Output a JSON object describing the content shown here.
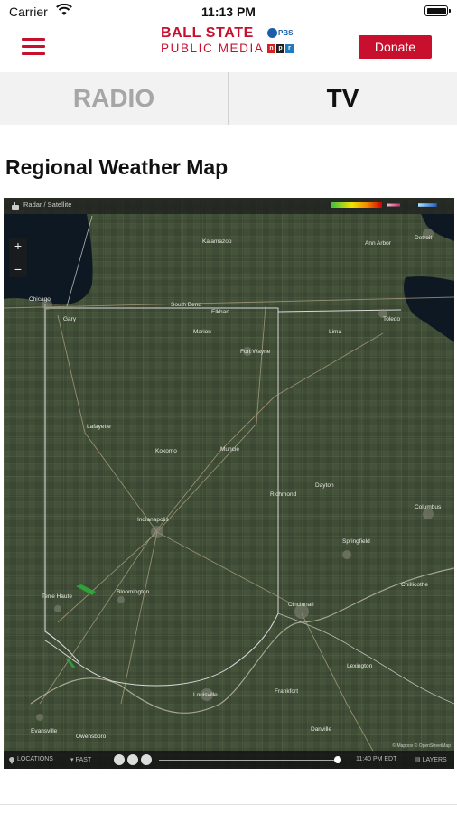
{
  "status_bar": {
    "carrier": "Carrier",
    "time": "11:13 PM"
  },
  "header": {
    "brand_line1": "BALL STATE",
    "brand_line2": "PUBLIC MEDIA",
    "pbs_label": "PBS",
    "npr_letters": [
      "n",
      "p",
      "r"
    ],
    "npr_colors": [
      "#d62021",
      "#1e1e1e",
      "#237bbd"
    ],
    "donate_label": "Donate",
    "accent_color": "#c8102e"
  },
  "tabs": [
    {
      "label": "RADIO",
      "active": false
    },
    {
      "label": "TV",
      "active": true
    }
  ],
  "page_title": "Regional Weather Map",
  "map": {
    "layer_label": "Radar / Satellite",
    "zoom_in": "+",
    "zoom_out": "−",
    "locations_label": "LOCATIONS",
    "past_label": "PAST",
    "timestamp": "11:40 PM EDT",
    "layers_label": "LAYERS",
    "attribution": "© Mapbox © OpenStreetMap",
    "cities": [
      "Chicago",
      "Gary",
      "Kalamazoo",
      "Detroit",
      "Ann Arbor",
      "Toledo",
      "South Bend",
      "Elkhart",
      "Fort Wayne",
      "Lima",
      "Lafayette",
      "Kokomo",
      "Muncie",
      "Indianapolis",
      "Richmond",
      "Dayton",
      "Springfield",
      "Columbus",
      "Terre Haute",
      "Bloomington",
      "Cincinnati",
      "Chillicothe",
      "Louisville",
      "Evansville",
      "Owensboro",
      "Frankfort",
      "Lexington",
      "Danville",
      "Marion"
    ]
  }
}
